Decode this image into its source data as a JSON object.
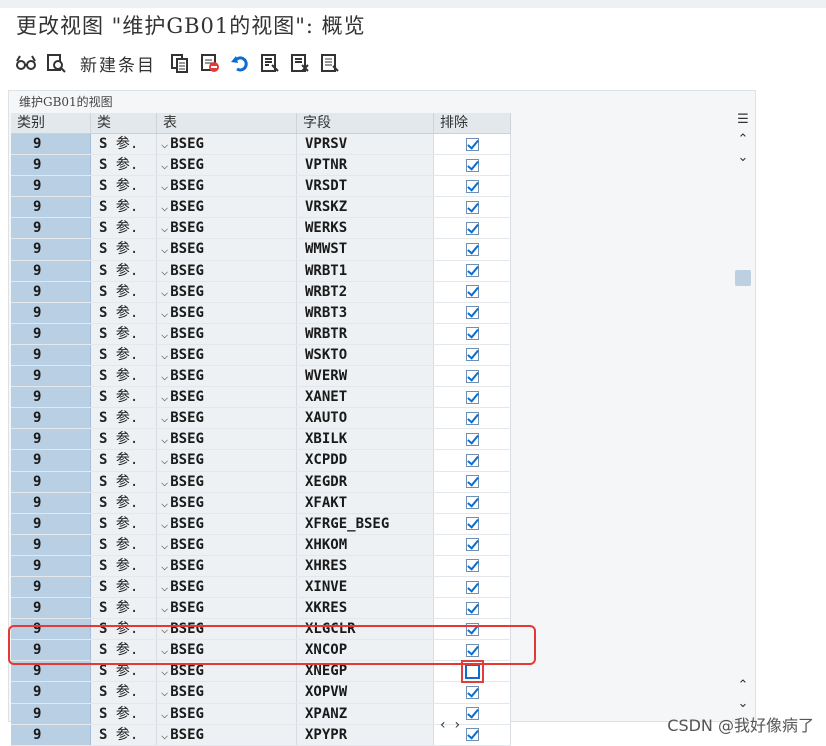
{
  "window": {
    "title": "更改视图 \"维护GB01的视图\": 概览"
  },
  "toolbar": {
    "new_entries_label": "新建条目",
    "icons": [
      "glasses-icon",
      "other-view-icon",
      "copy-icon",
      "delete-icon",
      "undo-icon",
      "select-all-icon",
      "select-block-icon",
      "deselect-all-icon"
    ]
  },
  "panel": {
    "label": "维护GB01的视图"
  },
  "table": {
    "headers": {
      "category": "类别",
      "type": "类",
      "table": "表",
      "field": "字段",
      "exclude": "排除"
    },
    "rows": [
      {
        "cat": "9",
        "type": "参.",
        "table": "BSEG",
        "field": "VPRSV",
        "exclude": true
      },
      {
        "cat": "9",
        "type": "参.",
        "table": "BSEG",
        "field": "VPTNR",
        "exclude": true
      },
      {
        "cat": "9",
        "type": "参.",
        "table": "BSEG",
        "field": "VRSDT",
        "exclude": true
      },
      {
        "cat": "9",
        "type": "参.",
        "table": "BSEG",
        "field": "VRSKZ",
        "exclude": true
      },
      {
        "cat": "9",
        "type": "参.",
        "table": "BSEG",
        "field": "WERKS",
        "exclude": true
      },
      {
        "cat": "9",
        "type": "参.",
        "table": "BSEG",
        "field": "WMWST",
        "exclude": true
      },
      {
        "cat": "9",
        "type": "参.",
        "table": "BSEG",
        "field": "WRBT1",
        "exclude": true
      },
      {
        "cat": "9",
        "type": "参.",
        "table": "BSEG",
        "field": "WRBT2",
        "exclude": true
      },
      {
        "cat": "9",
        "type": "参.",
        "table": "BSEG",
        "field": "WRBT3",
        "exclude": true
      },
      {
        "cat": "9",
        "type": "参.",
        "table": "BSEG",
        "field": "WRBTR",
        "exclude": true
      },
      {
        "cat": "9",
        "type": "参.",
        "table": "BSEG",
        "field": "WSKTO",
        "exclude": true
      },
      {
        "cat": "9",
        "type": "参.",
        "table": "BSEG",
        "field": "WVERW",
        "exclude": true
      },
      {
        "cat": "9",
        "type": "参.",
        "table": "BSEG",
        "field": "XANET",
        "exclude": true
      },
      {
        "cat": "9",
        "type": "参.",
        "table": "BSEG",
        "field": "XAUTO",
        "exclude": true
      },
      {
        "cat": "9",
        "type": "参.",
        "table": "BSEG",
        "field": "XBILK",
        "exclude": true
      },
      {
        "cat": "9",
        "type": "参.",
        "table": "BSEG",
        "field": "XCPDD",
        "exclude": true
      },
      {
        "cat": "9",
        "type": "参.",
        "table": "BSEG",
        "field": "XEGDR",
        "exclude": true
      },
      {
        "cat": "9",
        "type": "参.",
        "table": "BSEG",
        "field": "XFAKT",
        "exclude": true
      },
      {
        "cat": "9",
        "type": "参.",
        "table": "BSEG",
        "field": "XFRGE_BSEG",
        "exclude": true
      },
      {
        "cat": "9",
        "type": "参.",
        "table": "BSEG",
        "field": "XHKOM",
        "exclude": true
      },
      {
        "cat": "9",
        "type": "参.",
        "table": "BSEG",
        "field": "XHRES",
        "exclude": true
      },
      {
        "cat": "9",
        "type": "参.",
        "table": "BSEG",
        "field": "XINVE",
        "exclude": true
      },
      {
        "cat": "9",
        "type": "参.",
        "table": "BSEG",
        "field": "XKRES",
        "exclude": true
      },
      {
        "cat": "9",
        "type": "参.",
        "table": "BSEG",
        "field": "XLGCLR",
        "exclude": true
      },
      {
        "cat": "9",
        "type": "参.",
        "table": "BSEG",
        "field": "XNCOP",
        "exclude": true
      },
      {
        "cat": "9",
        "type": "参.",
        "table": "BSEG",
        "field": "XNEGP",
        "exclude": false,
        "focused": true
      },
      {
        "cat": "9",
        "type": "参.",
        "table": "BSEG",
        "field": "XOPVW",
        "exclude": true
      },
      {
        "cat": "9",
        "type": "参.",
        "table": "BSEG",
        "field": "XPANZ",
        "exclude": true
      },
      {
        "cat": "9",
        "type": "参.",
        "table": "BSEG",
        "field": "XPYPR",
        "exclude": true
      }
    ]
  },
  "type_prefix": "S",
  "watermark": "CSDN @我好像病了",
  "colors": {
    "accent": "#0a6ed1",
    "highlight": "#e53935",
    "key_column": "#b9cfe4"
  }
}
